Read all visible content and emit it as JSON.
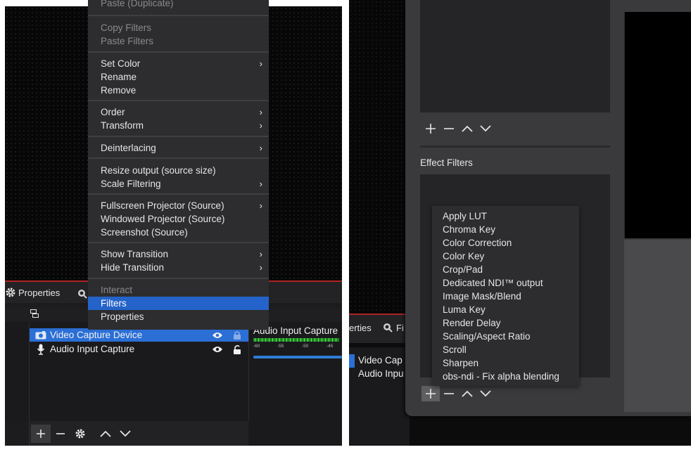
{
  "left_panel": {
    "dock_tabs": {
      "properties": "Properties"
    },
    "sources": [
      {
        "label": "Video Capture Device",
        "selected": true
      },
      {
        "label": "Audio Input Capture",
        "selected": false
      }
    ],
    "mixer": {
      "label": "Audio Input Capture",
      "ticks": [
        "-60",
        "-55",
        "-50",
        "-45"
      ]
    }
  },
  "context_menu": {
    "items": [
      {
        "label": "Paste (Duplicate)",
        "disabled": true,
        "submenu": false,
        "highlighted": false
      },
      {
        "label": "Copy Filters",
        "disabled": true,
        "submenu": false,
        "highlighted": false
      },
      {
        "label": "Paste Filters",
        "disabled": true,
        "submenu": false,
        "highlighted": false
      },
      {
        "label": "Set Color",
        "disabled": false,
        "submenu": true,
        "highlighted": false
      },
      {
        "label": "Rename",
        "disabled": false,
        "submenu": false,
        "highlighted": false
      },
      {
        "label": "Remove",
        "disabled": false,
        "submenu": false,
        "highlighted": false
      },
      {
        "label": "Order",
        "disabled": false,
        "submenu": true,
        "highlighted": false
      },
      {
        "label": "Transform",
        "disabled": false,
        "submenu": true,
        "highlighted": false
      },
      {
        "label": "Deinterlacing",
        "disabled": false,
        "submenu": true,
        "highlighted": false
      },
      {
        "label": "Resize output (source size)",
        "disabled": false,
        "submenu": false,
        "highlighted": false
      },
      {
        "label": "Scale Filtering",
        "disabled": false,
        "submenu": true,
        "highlighted": false
      },
      {
        "label": "Fullscreen Projector (Source)",
        "disabled": false,
        "submenu": true,
        "highlighted": false
      },
      {
        "label": "Windowed Projector (Source)",
        "disabled": false,
        "submenu": false,
        "highlighted": false
      },
      {
        "label": "Screenshot (Source)",
        "disabled": false,
        "submenu": false,
        "highlighted": false
      },
      {
        "label": "Show Transition",
        "disabled": false,
        "submenu": true,
        "highlighted": false
      },
      {
        "label": "Hide Transition",
        "disabled": false,
        "submenu": true,
        "highlighted": false
      },
      {
        "label": "Interact",
        "disabled": true,
        "submenu": false,
        "highlighted": false
      },
      {
        "label": "Filters",
        "disabled": false,
        "submenu": false,
        "highlighted": true
      },
      {
        "label": "Properties",
        "disabled": false,
        "submenu": false,
        "highlighted": false
      }
    ]
  },
  "right_panel": {
    "background": {
      "tab_properties": "erties",
      "tab_filters": "Fi",
      "sources": [
        "Video Cap",
        "Audio Inpu"
      ]
    },
    "filters_window": {
      "effect_filters_heading": "Effect Filters"
    },
    "add_filter_menu": {
      "items": [
        "Apply LUT",
        "Chroma Key",
        "Color Correction",
        "Color Key",
        "Crop/Pad",
        "Dedicated NDI™ output",
        "Image Mask/Blend",
        "Luma Key",
        "Render Delay",
        "Scaling/Aspect Ratio",
        "Scroll",
        "Sharpen",
        "obs-ndi - Fix alpha blending"
      ]
    }
  },
  "colors": {
    "selection": "#2b6fd6",
    "menu_highlight": "#2463c9",
    "preview_border": "#b02323",
    "menu_bg": "#2d2d2f",
    "meter_green": "#1a8a1a"
  },
  "icons": [
    "gear-icon",
    "filter-icon",
    "scene-icon",
    "camera-icon",
    "microphone-icon",
    "eye-icon",
    "lock-icon",
    "plus-icon",
    "minus-icon",
    "chevron-up-icon",
    "chevron-down-icon",
    "chevron-right-icon"
  ]
}
